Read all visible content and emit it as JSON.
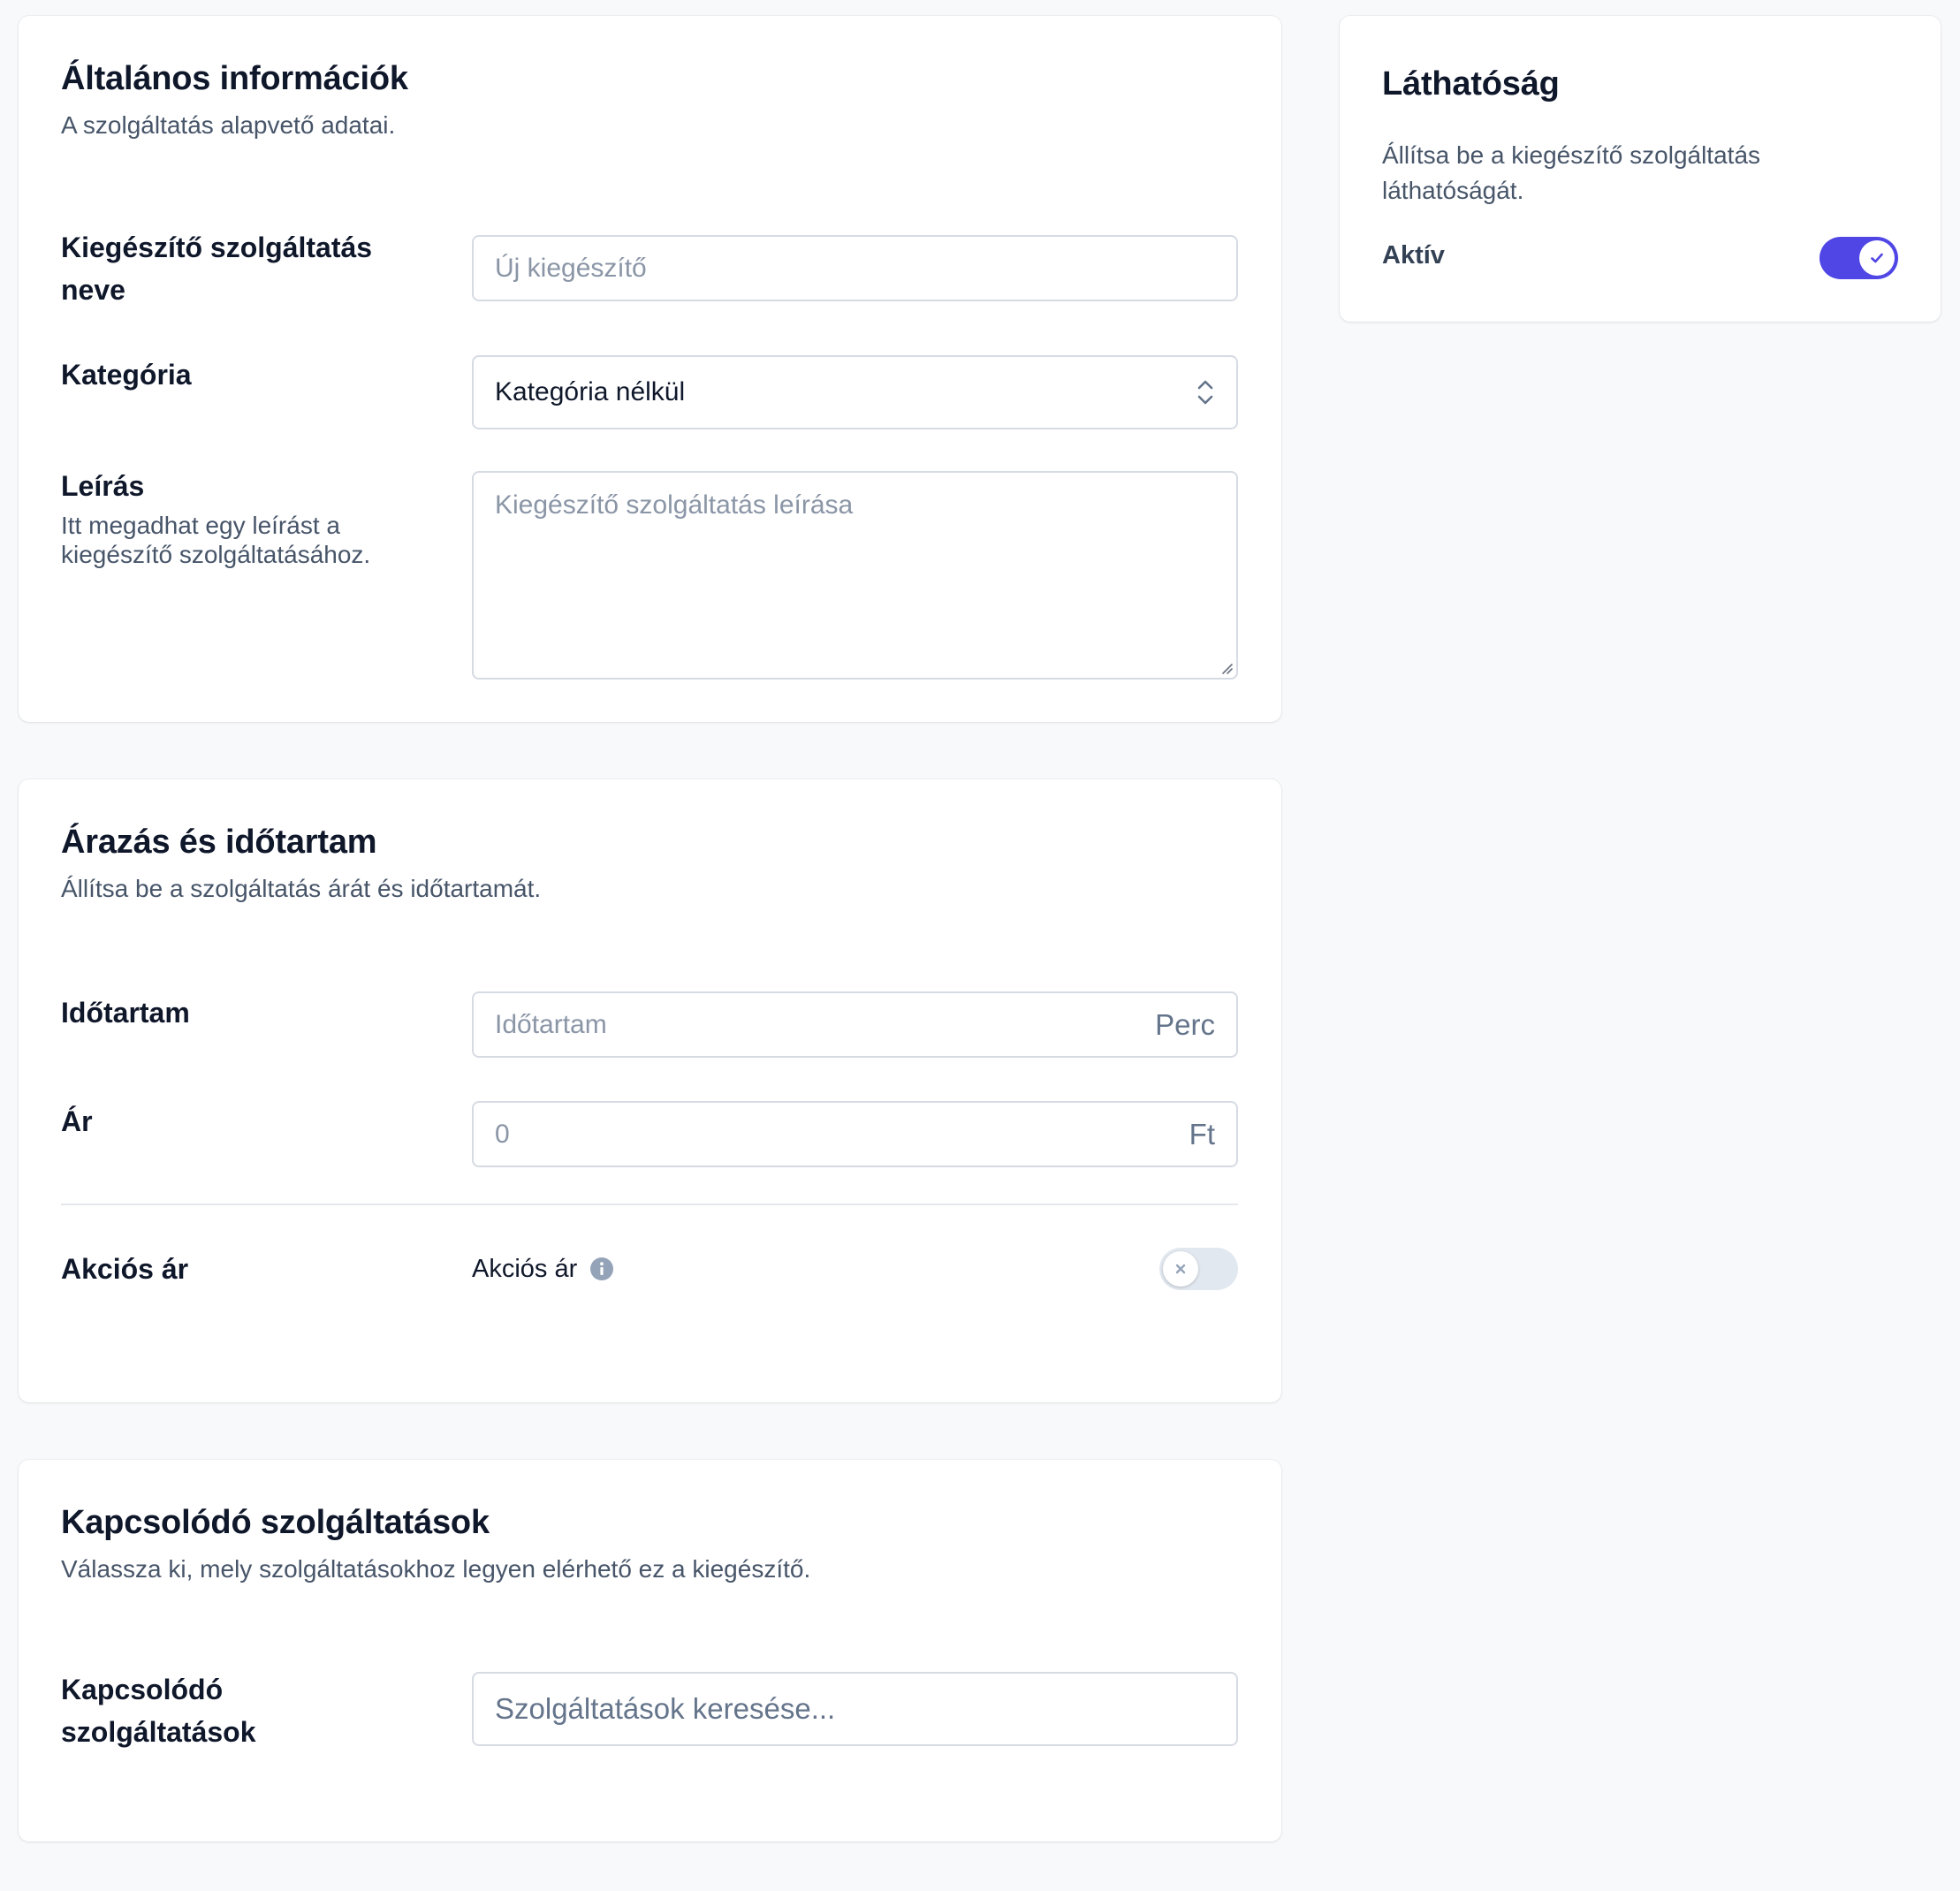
{
  "general": {
    "title": "Általános információk",
    "subtitle": "A szolgáltatás alapvető adatai.",
    "name_label": "Kiegészítő szolgáltatás neve",
    "name_placeholder": "Új kiegészítő",
    "category_label": "Kategória",
    "category_value": "Kategória nélkül",
    "description_label": "Leírás",
    "description_help": "Itt megadhat egy leírást a kiegészítő szolgáltatásához.",
    "description_placeholder": "Kiegészítő szolgáltatás leírása"
  },
  "pricing": {
    "title": "Árazás és időtartam",
    "subtitle": "Állítsa be a szolgáltatás árát és időtartamát.",
    "duration_label": "Időtartam",
    "duration_placeholder": "Időtartam",
    "duration_suffix": "Perc",
    "price_label": "Ár",
    "price_placeholder": "0",
    "price_suffix": "Ft",
    "sale_label": "Akciós ár",
    "sale_toggle_label": "Akciós ár",
    "sale_enabled": false
  },
  "related": {
    "title": "Kapcsolódó szolgáltatások",
    "subtitle": "Válassza ki, mely szolgáltatásokhoz legyen elérhető ez a kiegészítő.",
    "label": "Kapcsolódó szolgáltatások",
    "search_placeholder": "Szolgáltatások keresése..."
  },
  "visibility": {
    "title": "Láthatóság",
    "description": "Állítsa be a kiegészítő szolgáltatás láthatóságát.",
    "active_label": "Aktív",
    "active_enabled": true
  },
  "colors": {
    "accent": "#4f46e5",
    "toggle_off": "#e2e8f0"
  },
  "icons": {
    "select": "chevron-up-down-icon",
    "info": "info-icon",
    "check": "check-icon",
    "x": "x-icon",
    "resize": "resize-handle-icon"
  }
}
